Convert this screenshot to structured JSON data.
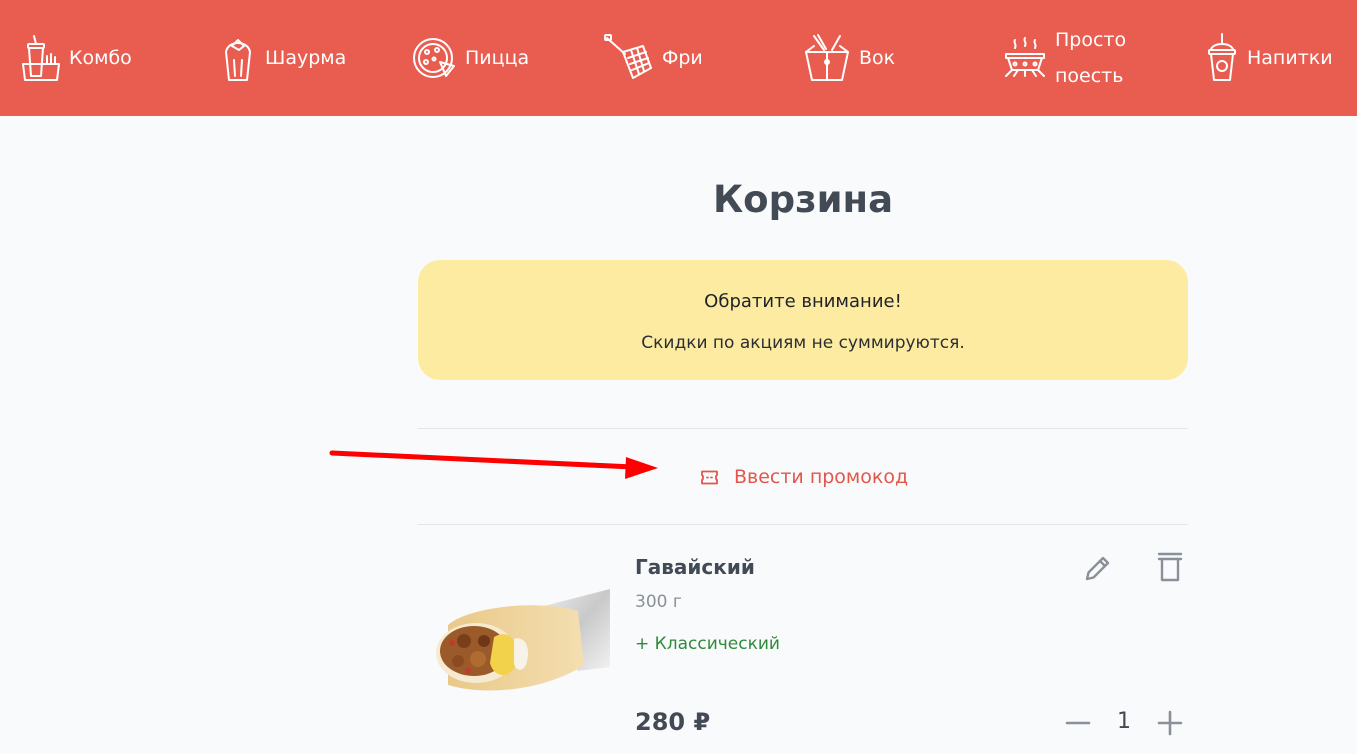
{
  "colors": {
    "accent": "#e95d51",
    "notice_bg": "#fdeba1",
    "promo_text": "#e2574c",
    "addon_text": "#2f8a3b",
    "arrow": "#ff0000"
  },
  "nav": {
    "items": [
      {
        "label": "Комбо",
        "icon": "combo-drink-icon"
      },
      {
        "label": "Шаурма",
        "icon": "shawarma-icon"
      },
      {
        "label": "Пицца",
        "icon": "pizza-icon"
      },
      {
        "label": "Фри",
        "icon": "fries-basket-icon"
      },
      {
        "label": "Вок",
        "icon": "wok-box-icon"
      },
      {
        "label": "Просто поесть",
        "icon": "hot-dish-icon"
      },
      {
        "label": "Напитки",
        "icon": "drink-cup-icon"
      }
    ]
  },
  "cart": {
    "title": "Корзина",
    "notice": {
      "title": "Обратите внимание!",
      "text": "Скидки по акциям не суммируются."
    },
    "promo": {
      "label": "Ввести промокод",
      "icon": "ticket-icon"
    },
    "items": [
      {
        "name": "Гавайский",
        "weight": "300 г",
        "addon": "+ Классический",
        "price": "280 ₽",
        "quantity": "1",
        "image": "shawarma-roll-image"
      }
    ]
  }
}
